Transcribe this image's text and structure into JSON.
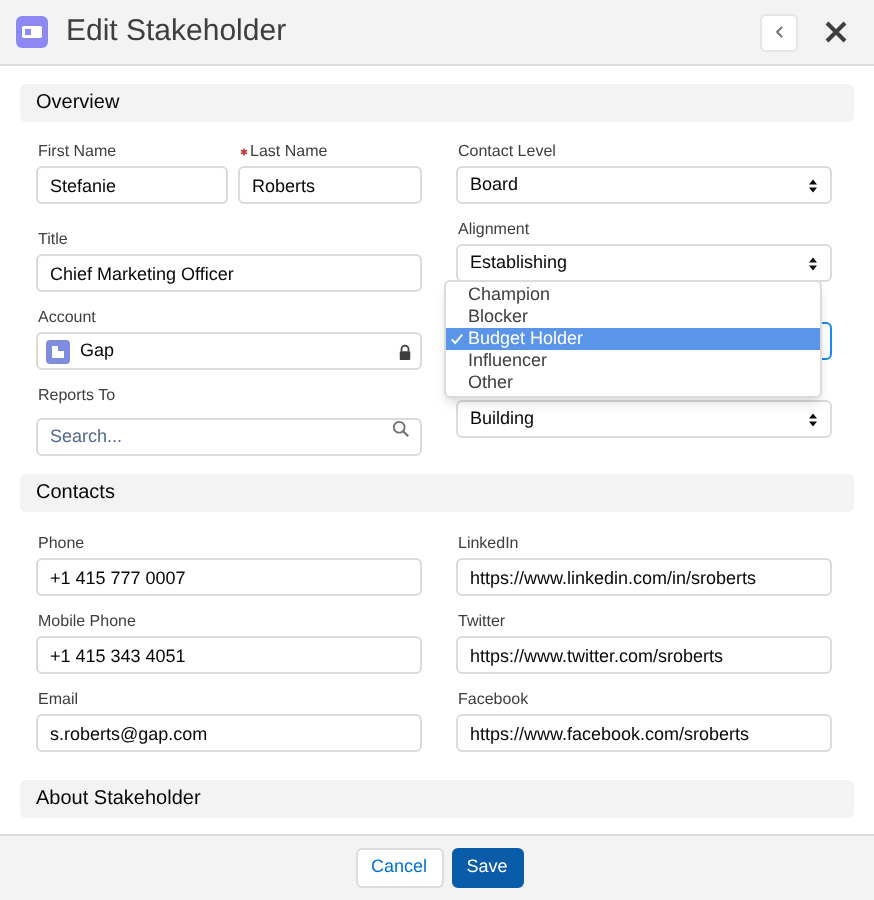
{
  "dialog": {
    "title": "Edit Stakeholder"
  },
  "overview": {
    "heading": "Overview",
    "name_fields": [
      {
        "label": "First Name",
        "value": "Stefanie",
        "required": false
      },
      {
        "label": "Last Name",
        "value": "Roberts",
        "required": true
      }
    ],
    "left_fields": [
      {
        "kind": "text",
        "label": "Title",
        "value": "Chief Marketing Officer"
      },
      {
        "kind": "lookup",
        "label": "Account",
        "value": "Gap",
        "locked": true
      },
      {
        "kind": "search",
        "label": "Reports To",
        "placeholder": "Search..."
      }
    ],
    "right_fields": [
      {
        "kind": "select",
        "label": "Contact Level",
        "value": "Board",
        "focused": false
      },
      {
        "kind": "select",
        "label": "Alignment",
        "value": "Establishing",
        "focused": false
      },
      {
        "kind": "select",
        "focused": true
      },
      {
        "kind": "select",
        "value": "Building",
        "focused": false
      }
    ]
  },
  "dropdown": {
    "options": [
      {
        "label": "Champion",
        "selected": false
      },
      {
        "label": "Blocker",
        "selected": false
      },
      {
        "label": "Budget Holder",
        "selected": true
      },
      {
        "label": "Influencer",
        "selected": false
      },
      {
        "label": "Other",
        "selected": false
      }
    ]
  },
  "contacts": {
    "heading": "Contacts",
    "left_fields": [
      {
        "label": "Phone",
        "value": "+1 415 777 0007"
      },
      {
        "label": "Mobile Phone",
        "value": "+1 415 343 4051"
      },
      {
        "label": "Email",
        "value": "s.roberts@gap.com"
      }
    ],
    "right_fields": [
      {
        "label": "LinkedIn",
        "value": "https://www.linkedin.com/in/sroberts"
      },
      {
        "label": "Twitter",
        "value": "https://www.twitter.com/sroberts"
      },
      {
        "label": "Facebook",
        "value": "https://www.facebook.com/sroberts"
      }
    ]
  },
  "about": {
    "heading": "About Stakeholder"
  },
  "buttons": [
    {
      "label": "Cancel",
      "kind": "neutral"
    },
    {
      "label": "Save",
      "kind": "brand"
    }
  ]
}
